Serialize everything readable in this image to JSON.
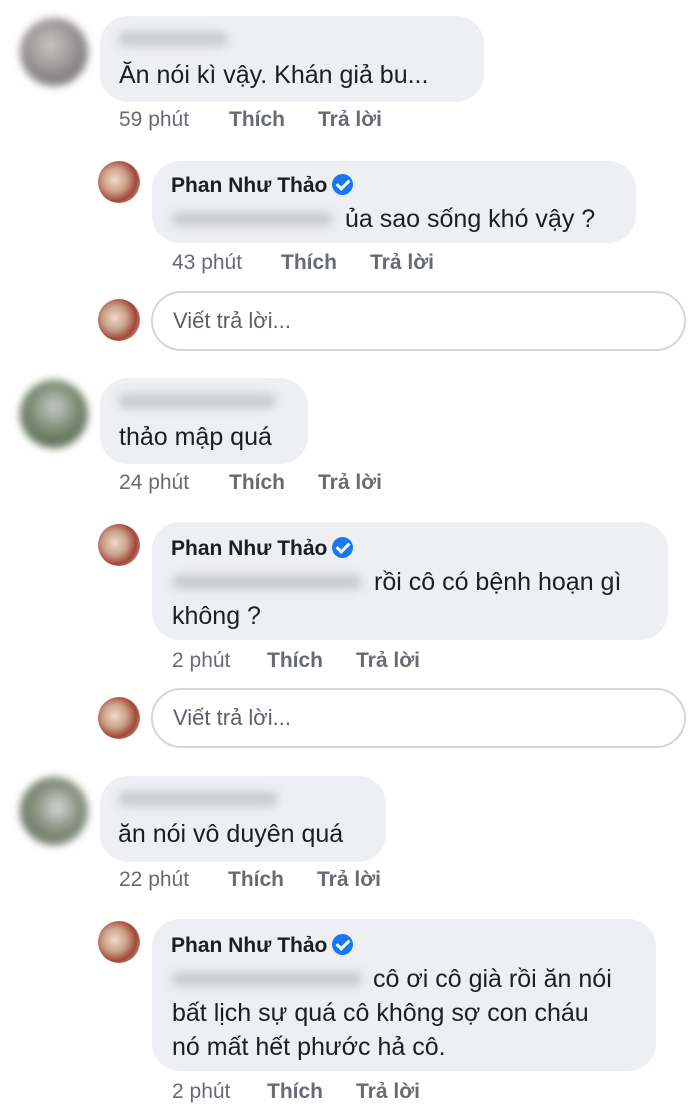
{
  "threads": [
    {
      "comment": {
        "text": "Ăn nói kì vậy.  Khán giả bu...",
        "time": "59 phút"
      },
      "reply": {
        "author": "Phan Như Thảo",
        "text_lines": [
          "ủa sao sống khó vậy ?"
        ],
        "time": "43 phút"
      }
    },
    {
      "comment": {
        "text": "thảo mập quá",
        "time": "24 phút"
      },
      "reply": {
        "author": "Phan Như Thảo",
        "text_lines": [
          "rồi cô có bệnh hoạn gì",
          "không ?"
        ],
        "time": "2 phút"
      }
    },
    {
      "comment": {
        "text": "ăn nói vô duyên quá",
        "time": "22 phút"
      },
      "reply": {
        "author": "Phan Như Thảo",
        "text_lines": [
          "cô ơi cô già rồi ăn nói",
          "bất lịch sự quá cô không sợ con cháu",
          "nó mất hết phước hả cô."
        ],
        "time": "2 phút"
      }
    }
  ],
  "actions": {
    "like": "Thích",
    "reply": "Trả lời"
  },
  "reply_input": {
    "placeholder": "Viết trả lời..."
  },
  "colors": {
    "bubble": "#eeeff2",
    "verified": "#1877f2",
    "meta": "#686b72"
  },
  "icons": {
    "verified": "verified-badge-icon"
  }
}
